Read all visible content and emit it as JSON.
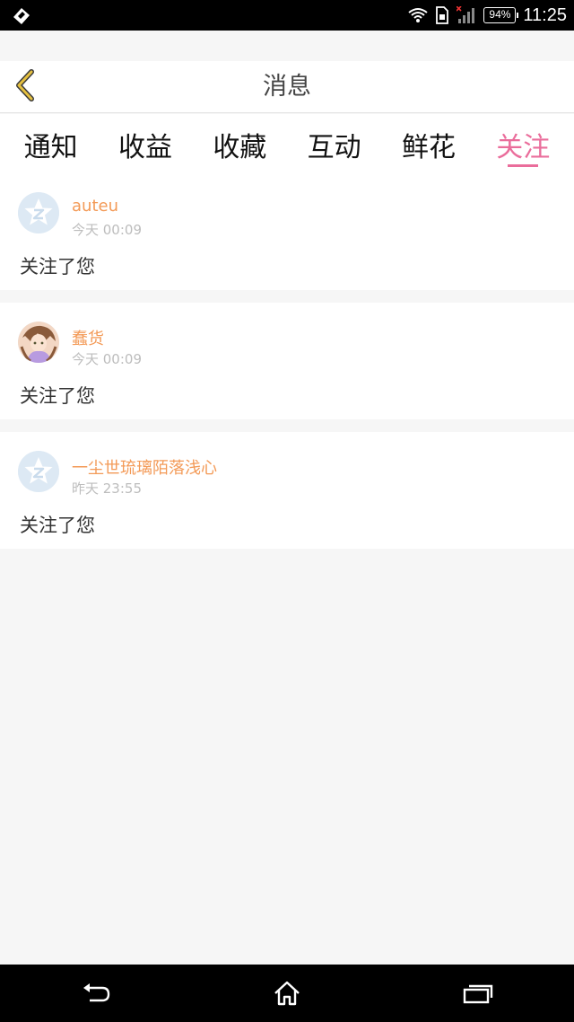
{
  "status_bar": {
    "time": "11:25",
    "battery": "94%",
    "icons": [
      "app-notification-icon",
      "wifi-icon",
      "sim-icon",
      "signal-icon",
      "battery-icon"
    ]
  },
  "header": {
    "title": "消息",
    "back_icon": "back-chevron-icon"
  },
  "tabs": [
    {
      "label": "通知",
      "active": false
    },
    {
      "label": "收益",
      "active": false
    },
    {
      "label": "收藏",
      "active": false
    },
    {
      "label": "互动",
      "active": false
    },
    {
      "label": "鲜花",
      "active": false
    },
    {
      "label": "关注",
      "active": true
    }
  ],
  "messages": [
    {
      "user": "auteu",
      "time": "今天 00:09",
      "text": "关注了您",
      "avatar": "default-avatar-icon"
    },
    {
      "user": "蠢货",
      "time": "今天 00:09",
      "text": "关注了您",
      "avatar": "user-avatar-photo"
    },
    {
      "user": "一尘世琉璃陌落浅心",
      "time": "昨天 23:55",
      "text": "关注了您",
      "avatar": "default-avatar-icon"
    }
  ],
  "nav_bar": {
    "icons": [
      "back-nav-icon",
      "home-icon",
      "recent-apps-icon"
    ]
  },
  "colors": {
    "accent": "#ea6d9b",
    "username": "#f39a57",
    "back_chevron": "#e5c040"
  }
}
